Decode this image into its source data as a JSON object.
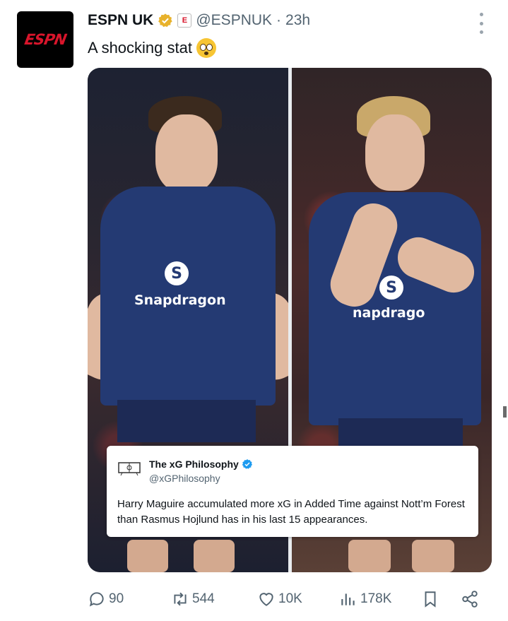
{
  "tweet": {
    "author_name": "ESPN UK",
    "author_handle": "@ESPNUK",
    "separator": "·",
    "time": "23h",
    "text": "A shocking stat",
    "avatar_logo": "ESPN",
    "affiliate_badge": "E",
    "icons": {
      "verified": "verified-badge-icon",
      "emoji": "flushed-face-emoji",
      "more": "more-options-icon"
    }
  },
  "media": {
    "left_sponsor": "Snapdragon",
    "right_sponsor": "napdrago",
    "sponsor_logo_glyph": "S",
    "quote_card": {
      "name": "The xG Philosophy",
      "handle": "@xGPhilosophy",
      "text": "Harry Maguire accumulated more xG in Added Time against Nott’m Forest than Rasmus Hojlund has in his last 15 appearances."
    }
  },
  "actions": {
    "replies": "90",
    "retweets": "544",
    "likes": "10K",
    "views": "178K",
    "icons": [
      "reply-icon",
      "retweet-icon",
      "like-icon",
      "views-icon",
      "bookmark-icon",
      "share-icon"
    ]
  },
  "colors": {
    "verified": "#e8b22c",
    "brand_red": "#d8152b",
    "kit_blue": "#243a73",
    "icon_gray": "#536471"
  }
}
